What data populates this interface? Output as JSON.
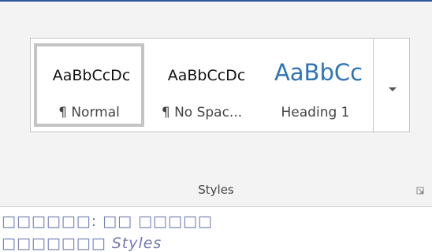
{
  "ribbon": {
    "group_label": "Styles",
    "styles_gallery": {
      "selected_index": 0,
      "items": [
        {
          "sample": "AaBbCcDc",
          "label": "¶ Normal"
        },
        {
          "sample": "AaBbCcDc",
          "label": "¶ No Spac..."
        },
        {
          "sample": "AaBbCc",
          "label": "Heading 1"
        }
      ]
    },
    "expand_icon": "chevron-down-icon",
    "launcher_icon": "dialog-launcher-icon"
  },
  "caption": {
    "line1": "□□□□□□: □□ □□□□□",
    "line2": "□□□□□□□ Styles"
  },
  "colors": {
    "ribbon_background": "#f3f3f3",
    "accent": "#2b579a",
    "heading_sample": "#2e74b5",
    "selection_border": "#c4c4c4",
    "caption_text": "#6f7ab3"
  }
}
